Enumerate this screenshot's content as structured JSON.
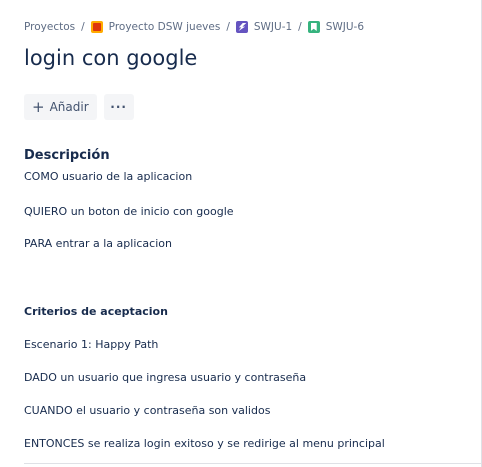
{
  "breadcrumb": {
    "projects": "Proyectos",
    "project": "Proyecto DSW jueves",
    "epic": "SWJU-1",
    "issue": "SWJU-6",
    "separator": "/"
  },
  "issue": {
    "title": "login con google"
  },
  "actions": {
    "add_label": "Añadir",
    "add_icon": "+",
    "more_label": "···"
  },
  "description": {
    "heading": "Descripción",
    "lines": [
      "COMO usuario de la aplicacion",
      "QUIERO un boton de inicio con google",
      "PARA entrar a la aplicacion"
    ],
    "criteria_heading": "Criterios de aceptacion",
    "criteria": [
      "Escenario 1: Happy Path",
      "DADO un usuario que ingresa usuario y contraseña",
      "CUANDO el usuario y contraseña son validos",
      "ENTONCES se realiza login exitoso y se redirige al menu principal"
    ]
  },
  "icons": {
    "project": "project-avatar-icon",
    "epic": "epic-icon",
    "story": "story-icon"
  },
  "colors": {
    "text": "#172b4d",
    "subtle": "#5e6c84",
    "button_bg": "#f4f5f7",
    "epic": "#6554c0",
    "story": "#36b37e",
    "project": "#ffab00"
  }
}
